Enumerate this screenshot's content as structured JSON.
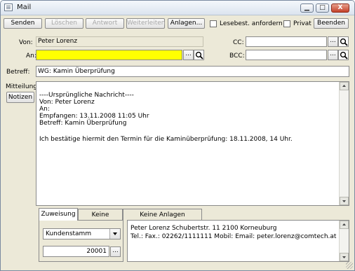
{
  "window": {
    "title": "Mail",
    "btn_min": "▁",
    "btn_max": "□",
    "btn_close": "X"
  },
  "toolbar": {
    "send": "Senden",
    "delete": "Löschen",
    "reply": "Antwort",
    "forward": "Weiterleiten",
    "attachments": "Anlagen...",
    "read_receipt": "Lesebest. anfordern",
    "private": "Privat",
    "close": "Beenden"
  },
  "header": {
    "from_label": "Von:",
    "from_value": "Peter Lorenz",
    "to_label": "An:",
    "to_value": "",
    "cc_label": "CC:",
    "cc_value": "",
    "bcc_label": "BCC:",
    "bcc_value": "",
    "subject_label": "Betreff:",
    "subject_value": "WG: Kamin Überprüfung",
    "message_label": "Mitteilung:",
    "notes_button": "Notizen",
    "browse": "..."
  },
  "body_lines": [
    "----Ursprüngliche Nachricht----",
    "Von: Peter Lorenz",
    "An:",
    "Empfangen: 13.11.2008 11:05 Uhr",
    "Betreff: Kamin Überprüfung",
    "",
    "Ich bestätige hiermit den Termin für die Kaminüberprüfung: 18.11.2008, 14 Uhr."
  ],
  "tabs": [
    "Zuweisung",
    "Keine Projekte",
    "Keine Anlagen vorhanden"
  ],
  "assignment": {
    "select_value": "Kundenstamm",
    "number_value": "20001",
    "browse": "..."
  },
  "contact": {
    "line1": "Peter Lorenz   Schubertstr. 11 2100  Korneuburg",
    "line2": "Tel.:  Fax.: 02262/1111111 Mobil:  Email: peter.lorenz@comtech.at"
  },
  "colors": {
    "to_field_bg": "#ffff00",
    "window_bg": "#ece9d8"
  }
}
